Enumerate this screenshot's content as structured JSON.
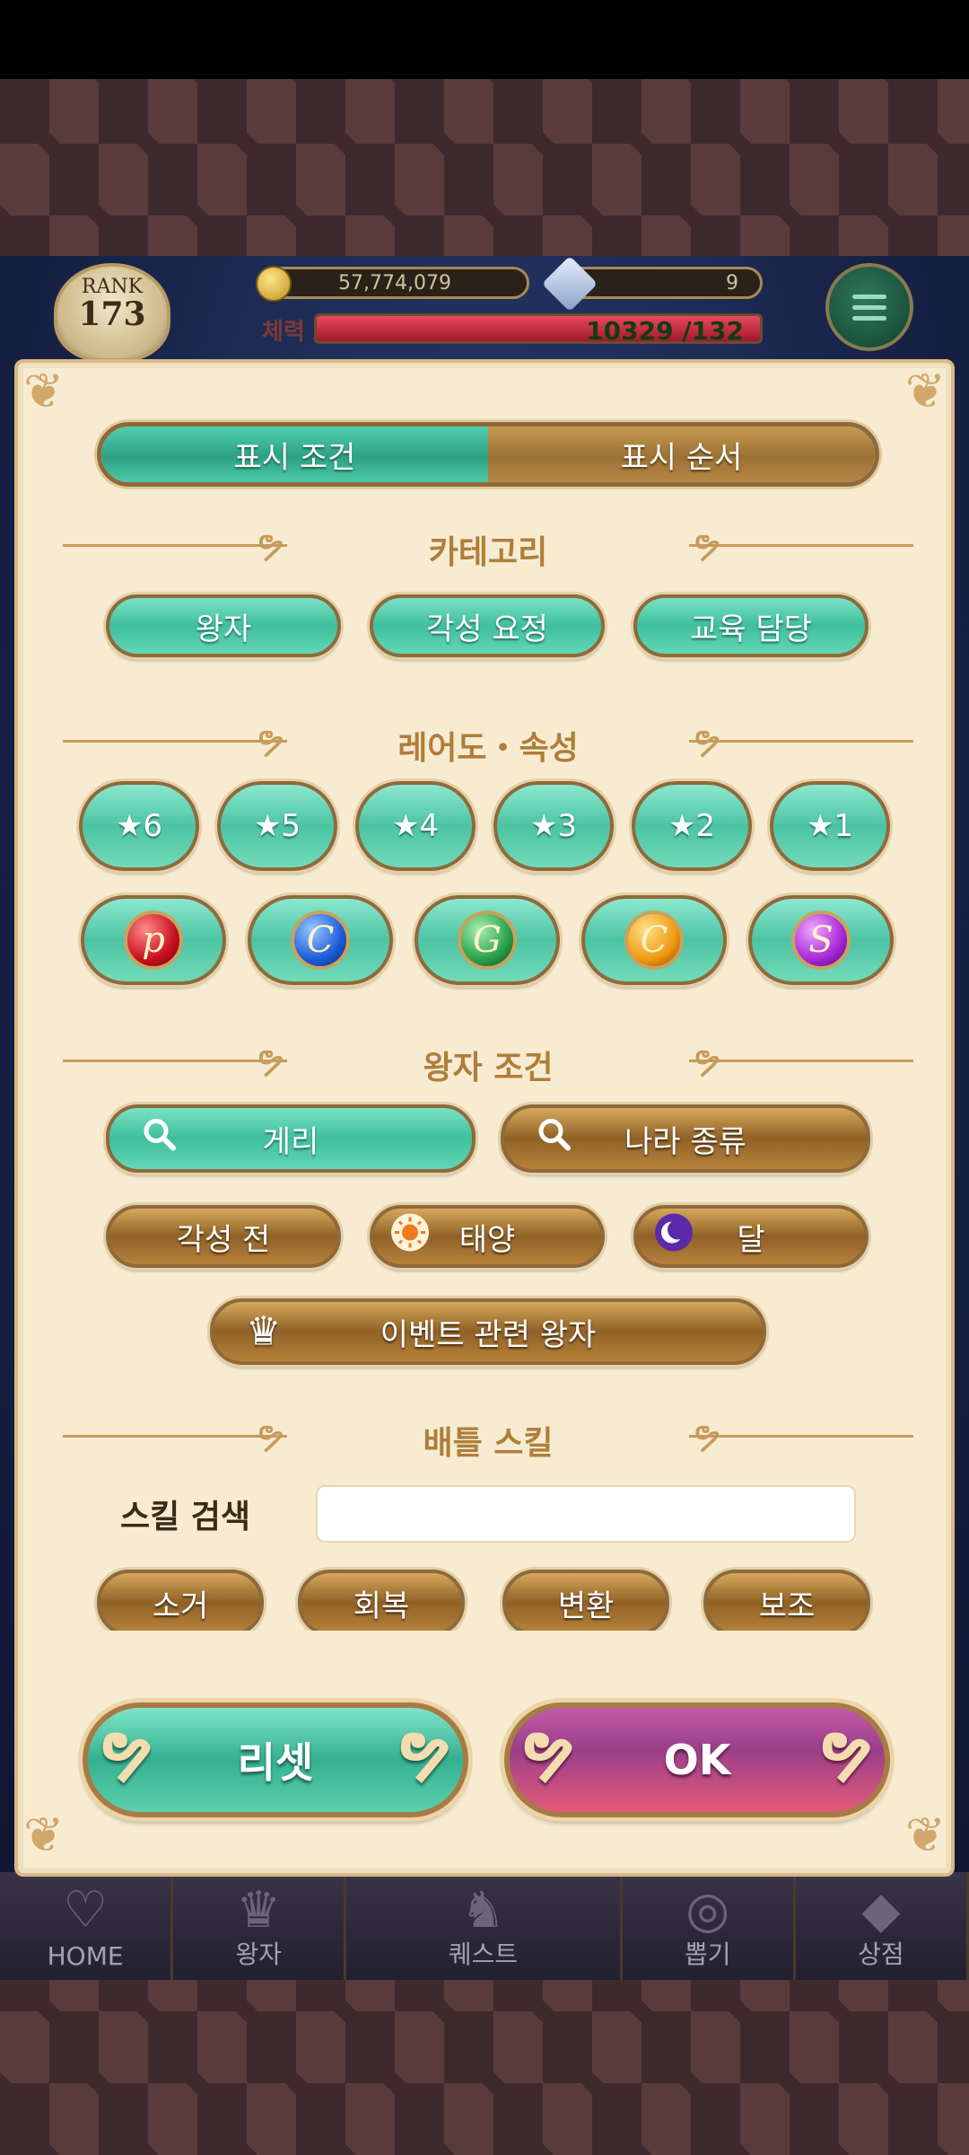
{
  "hud": {
    "rank_label": "RANK",
    "rank_value": "173",
    "gold": "57,774,079",
    "gems": "9",
    "stamina_label": "체력",
    "stamina_value": "10329 /132"
  },
  "nav": {
    "home": "HOME",
    "prince": "왕자",
    "quest": "퀘스트",
    "gacha": "뽑기",
    "shop": "상점"
  },
  "dialog": {
    "tabs": {
      "condition": "표시 조건",
      "order": "표시 순서"
    },
    "sections": {
      "category": "카테고리",
      "rarity_attr": "레어도・속성",
      "prince_condition": "왕자 조건",
      "battle_skill": "배틀 스킬"
    },
    "category_buttons": [
      "왕자",
      "각성 요정",
      "교육 담당"
    ],
    "rarity_buttons": [
      "★6",
      "★5",
      "★4",
      "★3",
      "★2",
      "★1"
    ],
    "attribute_letters": [
      "p",
      "C",
      "G",
      "C",
      "S"
    ],
    "prince_condition": {
      "series": "게리",
      "country": "나라 종류",
      "pre_awaken": "각성 전",
      "sun": "태양",
      "moon": "달",
      "event": "이벤트 관련 왕자"
    },
    "skill_search_label": "스킬 검색",
    "skill_search_value": "",
    "skill_types": [
      "소거",
      "회복",
      "변환",
      "보조"
    ],
    "reset": "리셋",
    "ok": "OK"
  },
  "colors": {
    "teal": "#3fbf9c",
    "gold": "#8f6126",
    "panel": "#f7ecd2",
    "header_text": "#b07e3a",
    "ok_button": "#9a3f8a"
  }
}
